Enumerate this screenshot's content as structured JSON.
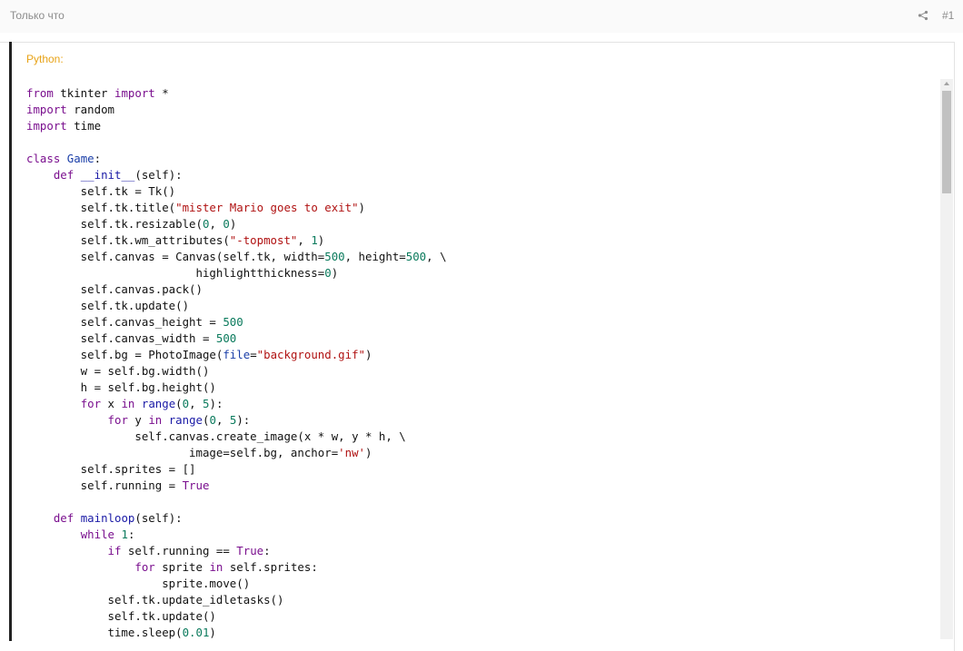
{
  "post": {
    "time": "Только что",
    "number": "#1",
    "share_icon": "share-icon"
  },
  "code_block": {
    "language_label": "Python:",
    "lines": [
      [
        [
          "k",
          "from"
        ],
        [
          "t",
          " tkinter "
        ],
        [
          "k",
          "import"
        ],
        [
          "t",
          " *"
        ]
      ],
      [
        [
          "k",
          "import"
        ],
        [
          "t",
          " random"
        ]
      ],
      [
        [
          "k",
          "import"
        ],
        [
          "t",
          " time"
        ]
      ],
      [],
      [
        [
          "k",
          "class"
        ],
        [
          "t",
          " "
        ],
        [
          "c",
          "Game"
        ],
        [
          "t",
          ":"
        ]
      ],
      [
        [
          "t",
          "    "
        ],
        [
          "k",
          "def"
        ],
        [
          "t",
          " "
        ],
        [
          "b",
          "__init__"
        ],
        [
          "t",
          "(self):"
        ]
      ],
      [
        [
          "t",
          "        self.tk = Tk()"
        ]
      ],
      [
        [
          "t",
          "        self.tk.title("
        ],
        [
          "s",
          "\"mister Mario goes to exit\""
        ],
        [
          "t",
          ")"
        ]
      ],
      [
        [
          "t",
          "        self.tk.resizable("
        ],
        [
          "n",
          "0"
        ],
        [
          "t",
          ", "
        ],
        [
          "n",
          "0"
        ],
        [
          "t",
          ")"
        ]
      ],
      [
        [
          "t",
          "        self.tk.wm_attributes("
        ],
        [
          "s",
          "\"-topmost\""
        ],
        [
          "t",
          ", "
        ],
        [
          "n",
          "1"
        ],
        [
          "t",
          ")"
        ]
      ],
      [
        [
          "t",
          "        self.canvas = Canvas(self.tk, width="
        ],
        [
          "n",
          "500"
        ],
        [
          "t",
          ", height="
        ],
        [
          "n",
          "500"
        ],
        [
          "t",
          ", \\"
        ]
      ],
      [
        [
          "t",
          "                         highlightthickness="
        ],
        [
          "n",
          "0"
        ],
        [
          "t",
          ")"
        ]
      ],
      [
        [
          "t",
          "        self.canvas.pack()"
        ]
      ],
      [
        [
          "t",
          "        self.tk.update()"
        ]
      ],
      [
        [
          "t",
          "        self.canvas_height = "
        ],
        [
          "n",
          "500"
        ]
      ],
      [
        [
          "t",
          "        self.canvas_width = "
        ],
        [
          "n",
          "500"
        ]
      ],
      [
        [
          "t",
          "        self.bg = PhotoImage("
        ],
        [
          "f",
          "file"
        ],
        [
          "t",
          "="
        ],
        [
          "s",
          "\"background.gif\""
        ],
        [
          "t",
          ")"
        ]
      ],
      [
        [
          "t",
          "        w = self.bg.width()"
        ]
      ],
      [
        [
          "t",
          "        h = self.bg.height()"
        ]
      ],
      [
        [
          "t",
          "        "
        ],
        [
          "k",
          "for"
        ],
        [
          "t",
          " x "
        ],
        [
          "k",
          "in"
        ],
        [
          "t",
          " "
        ],
        [
          "b",
          "range"
        ],
        [
          "t",
          "("
        ],
        [
          "n",
          "0"
        ],
        [
          "t",
          ", "
        ],
        [
          "n",
          "5"
        ],
        [
          "t",
          "):"
        ]
      ],
      [
        [
          "t",
          "            "
        ],
        [
          "k",
          "for"
        ],
        [
          "t",
          " y "
        ],
        [
          "k",
          "in"
        ],
        [
          "t",
          " "
        ],
        [
          "b",
          "range"
        ],
        [
          "t",
          "("
        ],
        [
          "n",
          "0"
        ],
        [
          "t",
          ", "
        ],
        [
          "n",
          "5"
        ],
        [
          "t",
          "):"
        ]
      ],
      [
        [
          "t",
          "                self.canvas.create_image(x * w, y * h, \\"
        ]
      ],
      [
        [
          "t",
          "                        image=self.bg, anchor="
        ],
        [
          "s",
          "'nw'"
        ],
        [
          "t",
          ")"
        ]
      ],
      [
        [
          "t",
          "        self.sprites = []"
        ]
      ],
      [
        [
          "t",
          "        self.running = "
        ],
        [
          "k",
          "True"
        ]
      ],
      [],
      [
        [
          "t",
          "    "
        ],
        [
          "k",
          "def"
        ],
        [
          "t",
          " "
        ],
        [
          "b",
          "mainloop"
        ],
        [
          "t",
          "(self):"
        ]
      ],
      [
        [
          "t",
          "        "
        ],
        [
          "k",
          "while"
        ],
        [
          "t",
          " "
        ],
        [
          "n",
          "1"
        ],
        [
          "t",
          ":"
        ]
      ],
      [
        [
          "t",
          "            "
        ],
        [
          "k",
          "if"
        ],
        [
          "t",
          " self.running == "
        ],
        [
          "k",
          "True"
        ],
        [
          "t",
          ":"
        ]
      ],
      [
        [
          "t",
          "                "
        ],
        [
          "k",
          "for"
        ],
        [
          "t",
          " sprite "
        ],
        [
          "k",
          "in"
        ],
        [
          "t",
          " self.sprites:"
        ]
      ],
      [
        [
          "t",
          "                    sprite.move()"
        ]
      ],
      [
        [
          "t",
          "            self.tk.update_idletasks()"
        ]
      ],
      [
        [
          "t",
          "            self.tk.update()"
        ]
      ],
      [
        [
          "t",
          "            time.sleep("
        ],
        [
          "n",
          "0.01"
        ],
        [
          "t",
          ")"
        ]
      ]
    ]
  }
}
